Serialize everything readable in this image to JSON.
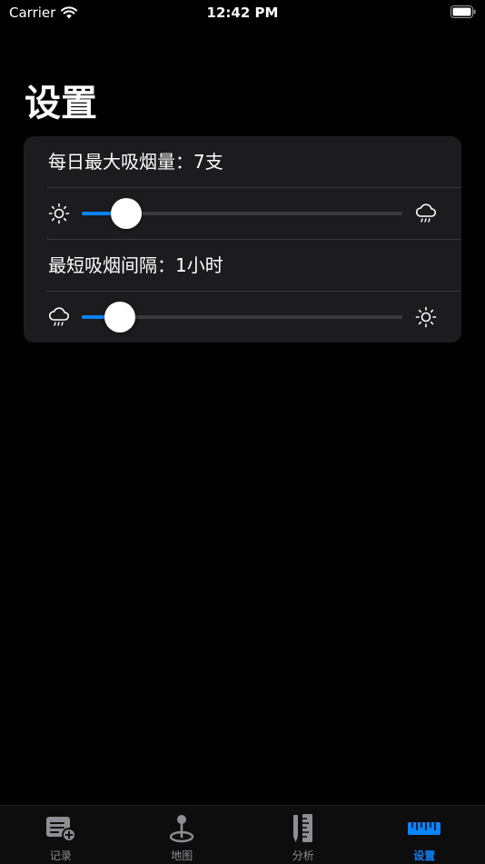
{
  "status_bar": {
    "carrier": "Carrier",
    "time": "12:42 PM"
  },
  "page": {
    "title": "设置"
  },
  "settings": {
    "max_daily": {
      "label": "每日最大吸烟量：7支",
      "level_fraction": 0.14,
      "left_icon": "sun-icon",
      "right_icon": "cloud-rain-icon"
    },
    "min_interval": {
      "label": "最短吸烟间隔：1小时",
      "level_fraction": 0.12,
      "left_icon": "cloud-rain-icon",
      "right_icon": "sun-icon"
    }
  },
  "tabs": [
    {
      "label": "记录",
      "icon": "list-add-icon",
      "active": false
    },
    {
      "label": "地图",
      "icon": "map-pin-icon",
      "active": false
    },
    {
      "label": "分析",
      "icon": "pencil-ruler-icon",
      "active": false
    },
    {
      "label": "设置",
      "icon": "ruler-icon",
      "active": true
    }
  ],
  "colors": {
    "accent": "#0a84ff",
    "card": "#1c1c1e",
    "inactive": "#8e8e93"
  }
}
